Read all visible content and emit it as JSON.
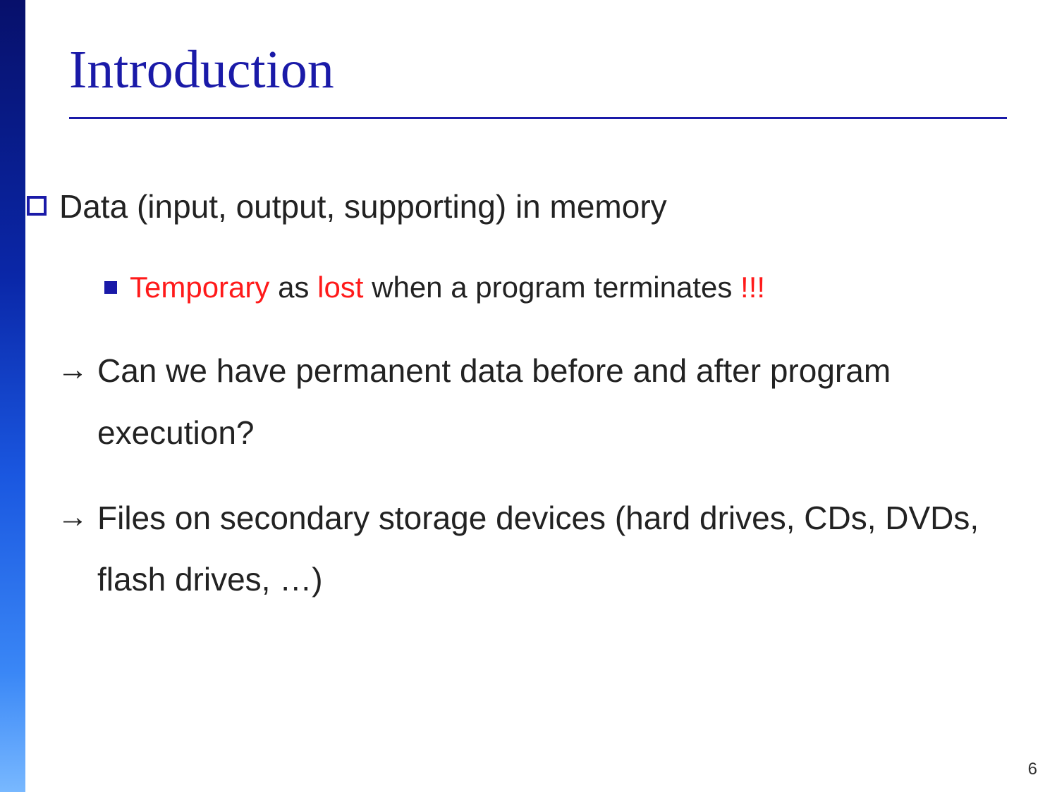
{
  "title": "Introduction",
  "bullets": {
    "b1": "Data (input, output, supporting) in memory",
    "b2": {
      "red1": "Temporary",
      "t1": " as ",
      "red2": "lost",
      "t2": " when a program terminates ",
      "red3": "!!!"
    },
    "b3": "Can we have permanent data before and after program execution?",
    "b4": "Files on secondary storage devices (hard drives, CDs, DVDs, flash drives, …)"
  },
  "page_number": "6"
}
